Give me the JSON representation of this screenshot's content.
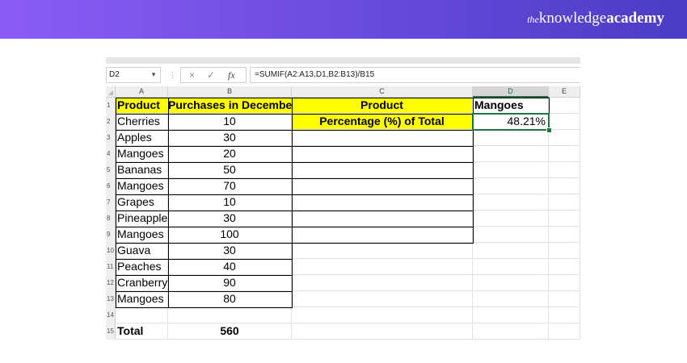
{
  "brand": {
    "prefix": "the",
    "name": "knowledge",
    "suffix": "academy"
  },
  "formula_bar": {
    "name_box": "D2",
    "cancel_symbol": "×",
    "enter_symbol": "✓",
    "fx_label": "fx",
    "formula": "=SUMIF(A2:A13,D1,B2:B13)/B15"
  },
  "columns": [
    "A",
    "B",
    "C",
    "D",
    "E"
  ],
  "rows": [
    {
      "num": "1",
      "a": "Product",
      "b": "Purchases in December",
      "c": "Product",
      "d": "Mangoes"
    },
    {
      "num": "2",
      "a": "Cherries",
      "b": "10",
      "c": "Percentage (%) of Total",
      "d": "48.21%"
    },
    {
      "num": "3",
      "a": "Apples",
      "b": "30",
      "c": "",
      "d": ""
    },
    {
      "num": "4",
      "a": "Mangoes",
      "b": "20",
      "c": "",
      "d": ""
    },
    {
      "num": "5",
      "a": "Bananas",
      "b": "50",
      "c": "",
      "d": ""
    },
    {
      "num": "6",
      "a": "Mangoes",
      "b": "70",
      "c": "",
      "d": ""
    },
    {
      "num": "7",
      "a": "Grapes",
      "b": "10",
      "c": "",
      "d": ""
    },
    {
      "num": "8",
      "a": "Pineapple",
      "b": "30",
      "c": "",
      "d": ""
    },
    {
      "num": "9",
      "a": "Mangoes",
      "b": "100",
      "c": "",
      "d": ""
    },
    {
      "num": "10",
      "a": "Guava",
      "b": "30",
      "c": "",
      "d": ""
    },
    {
      "num": "11",
      "a": "Peaches",
      "b": "40",
      "c": "",
      "d": ""
    },
    {
      "num": "12",
      "a": "Cranberry",
      "b": "90",
      "c": "",
      "d": ""
    },
    {
      "num": "13",
      "a": "Mangoes",
      "b": "80",
      "c": "",
      "d": ""
    },
    {
      "num": "14",
      "a": "",
      "b": "",
      "c": "",
      "d": ""
    },
    {
      "num": "15",
      "a": "Total",
      "b": "560",
      "c": "",
      "d": ""
    }
  ],
  "colors": {
    "banner_start": "#8b5cf6",
    "banner_end": "#4b3cc4",
    "highlight": "#ffff00",
    "selection": "#217346"
  }
}
